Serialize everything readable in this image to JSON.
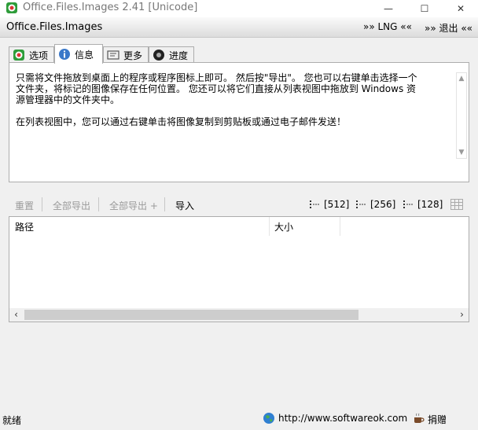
{
  "window": {
    "title": "Office.Files.Images 2.41 [Unicode]",
    "minimize_glyph": "—",
    "maximize_glyph": "☐",
    "close_glyph": "✕"
  },
  "menubar": {
    "app_title": "Office.Files.Images",
    "lng": "»» LNG ««",
    "exit": "»» 退出 ««"
  },
  "tabs": [
    {
      "label": "选项",
      "icon": "options-icon"
    },
    {
      "label": "信息",
      "icon": "info-icon",
      "active": true
    },
    {
      "label": "更多",
      "icon": "more-icon"
    },
    {
      "label": "进度",
      "icon": "progress-icon"
    }
  ],
  "info": {
    "paragraph1": "只需将文件拖放到桌面上的程序或程序图标上即可。 然后按\"导出\"。 您也可以右键单击选择一个文件夹，将标记的图像保存在任何位置。 您还可以将它们直接从列表视图中拖放到 Windows 资源管理器中的文件夹中。",
    "paragraph2": "在列表视图中，您可以通过右键单击将图像复制到剪贴板或通过电子邮件发送！"
  },
  "toolbar": {
    "reset": "重置",
    "export_all": "全部导出",
    "export_all_plus": "全部导出 +",
    "import": "导入",
    "size_512": "[512]",
    "size_256": "[256]",
    "size_128": "[128]"
  },
  "listview": {
    "columns": [
      "路径",
      "大小"
    ]
  },
  "statusbar": {
    "status": "就绪",
    "url": "http://www.softwareok.com",
    "donate": "捐赠"
  }
}
